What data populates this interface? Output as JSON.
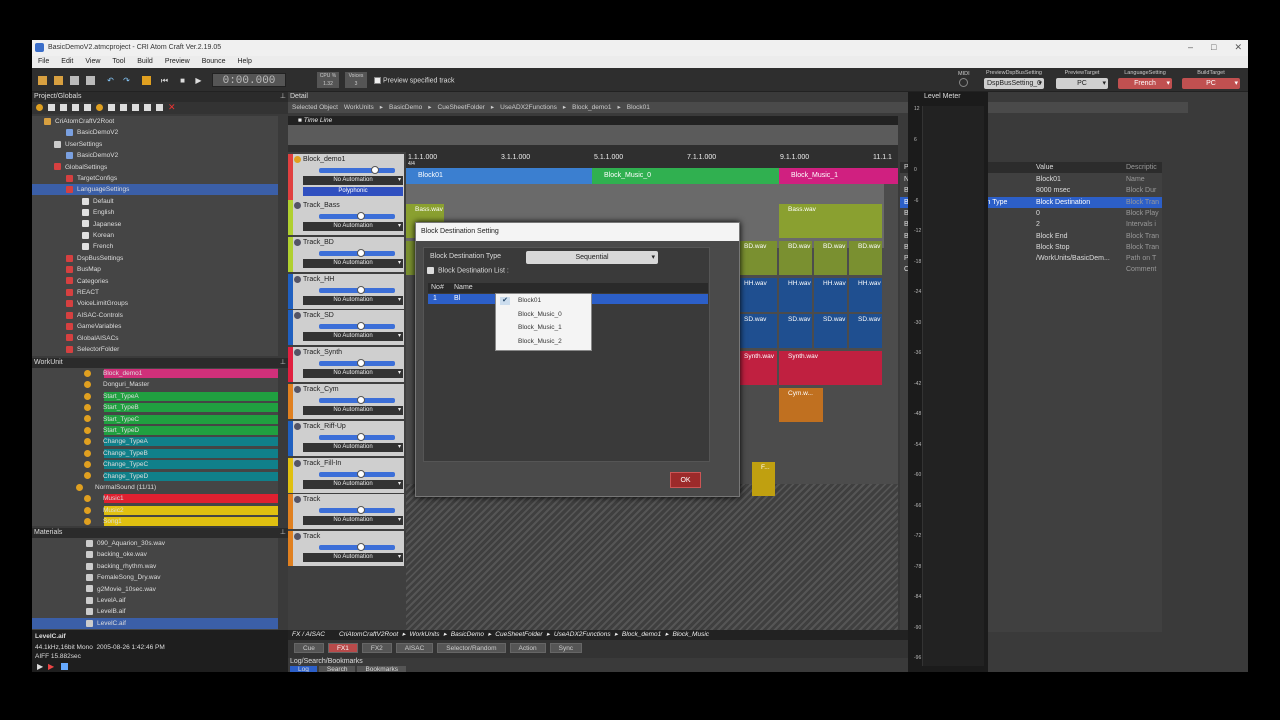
{
  "window": {
    "title": "BasicDemoV2.atmcproject - CRI Atom Craft Ver.2.19.05"
  },
  "menu": [
    "File",
    "Edit",
    "View",
    "Tool",
    "Build",
    "Preview",
    "Bounce",
    "Help"
  ],
  "toolbar": {
    "time": "0:00.000",
    "cpu_label": "CPU %",
    "cpu_value": "1.32",
    "voices_label": "Voices",
    "voices_value": "3",
    "preview_label": "Preview specified track",
    "midi_label": "MIDI",
    "selectors": [
      {
        "label": "PreviewDspBusSetting",
        "value": "DspBusSetting_0"
      },
      {
        "label": "PreviewTarget",
        "value": "PC"
      },
      {
        "label": "LanguageSetting",
        "value": "French"
      },
      {
        "label": "BuildTarget",
        "value": "PC"
      }
    ]
  },
  "project_panel": {
    "title": "Project/Globals",
    "items": [
      {
        "label": "CriAtomCraftV2Root",
        "color": "#d8a040"
      },
      {
        "label": "BasicDemoV2",
        "color": "#7aa0e0"
      },
      {
        "label": "UserSettings",
        "color": "#cccccc"
      },
      {
        "label": "BasicDemoV2",
        "color": "#7aa0e0"
      },
      {
        "label": "GlobalSettings",
        "color": "#d64040"
      },
      {
        "label": "TargetConfigs",
        "color": "#d64040"
      },
      {
        "label": "LanguageSettings",
        "color": "#d64040"
      },
      {
        "label": "Default",
        "color": "#e0e0e0"
      },
      {
        "label": "English",
        "color": "#e0e0e0"
      },
      {
        "label": "Japanese",
        "color": "#e0e0e0"
      },
      {
        "label": "Korean",
        "color": "#e0e0e0"
      },
      {
        "label": "French",
        "color": "#e0e0e0"
      },
      {
        "label": "DspBusSettings",
        "color": "#d64040"
      },
      {
        "label": "BusMap",
        "color": "#d64040"
      },
      {
        "label": "Categories",
        "color": "#d64040"
      },
      {
        "label": "REACT",
        "color": "#d64040"
      },
      {
        "label": "VoiceLimitGroups",
        "color": "#d64040"
      },
      {
        "label": "AISAC-Controls",
        "color": "#d64040"
      },
      {
        "label": "GameVariables",
        "color": "#d64040"
      },
      {
        "label": "GlobalAISACs",
        "color": "#d64040"
      },
      {
        "label": "SelectorFolder",
        "color": "#d64040"
      }
    ]
  },
  "workunit_panel": {
    "title": "WorkUnit",
    "items": [
      {
        "label": "Block_demo1",
        "color": "#d0307a"
      },
      {
        "label": "Donguri_Master",
        "color": ""
      },
      {
        "label": "Start_TypeA",
        "color": "#20a040"
      },
      {
        "label": "Start_TypeB",
        "color": "#20a040"
      },
      {
        "label": "Start_TypeC",
        "color": "#20a040"
      },
      {
        "label": "Start_TypeD",
        "color": "#20a040"
      },
      {
        "label": "Change_TypeA",
        "color": "#10808a"
      },
      {
        "label": "Change_TypeB",
        "color": "#10808a"
      },
      {
        "label": "Change_TypeC",
        "color": "#10808a"
      },
      {
        "label": "Change_TypeD",
        "color": "#10808a"
      },
      {
        "label": "NormalSound (11/11)",
        "color": ""
      },
      {
        "label": "Music1",
        "color": "#e02030"
      },
      {
        "label": "Music2",
        "color": "#e0c010"
      },
      {
        "label": "Song1",
        "color": "#e0c010"
      }
    ]
  },
  "materials_panel": {
    "title": "Materials",
    "items": [
      "090_Aquarion_30s.wav",
      "backing_oke.wav",
      "backing_rhythm.wav",
      "FemaleSong_Dry.wav",
      "g2Movie_10sec.wav",
      "LevelA.aif",
      "LevelB.aif",
      "LevelC.aif"
    ]
  },
  "file_info": {
    "name": "LevelC.aif",
    "format": "44.1kHz,16bit Mono",
    "date": "2005-08-26 1:42:46 PM",
    "type_len": "AIFF 15.882sec"
  },
  "detail": {
    "title": "Detail",
    "selected_label": "Selected Object",
    "path": [
      "WorkUnits",
      "BasicDemo",
      "CueSheetFolder",
      "UseADX2Functions",
      "Block_demo1",
      "Block01"
    ],
    "timeline_title": "Time Line"
  },
  "ruler": [
    "1.1.1.000",
    "3.1.1.000",
    "5.1.1.000",
    "7.1.1.000",
    "9.1.1.000",
    "11.1.1"
  ],
  "ruler_sub": "4/4",
  "blocks": [
    {
      "label": "Block01",
      "color": "#3b7fd0"
    },
    {
      "label": "Block_Music_0",
      "color": "#30b050"
    },
    {
      "label": "Block_Music_1",
      "color": "#d02080"
    }
  ],
  "tracks": [
    {
      "name": "Block_demo1",
      "color": "#e04040",
      "automation": "No Automation",
      "mode": "Polyphonic"
    },
    {
      "name": "Track_Bass",
      "color": "#b0d030",
      "automation": "No Automation"
    },
    {
      "name": "Track_BD",
      "color": "#b0d030",
      "automation": "No Automation"
    },
    {
      "name": "Track_HH",
      "color": "#2060c0",
      "automation": "No Automation"
    },
    {
      "name": "Track_SD",
      "color": "#2060c0",
      "automation": "No Automation"
    },
    {
      "name": "Track_Synth",
      "color": "#e02040",
      "automation": "No Automation"
    },
    {
      "name": "Track_Cym",
      "color": "#e08020",
      "automation": "No Automation"
    },
    {
      "name": "Track_Riff-Up",
      "color": "#2060c0",
      "automation": "No Automation"
    },
    {
      "name": "Track_Fill-In",
      "color": "#e0c010",
      "automation": "No Automation"
    },
    {
      "name": "Track",
      "color": "#e08020",
      "automation": "No Automation"
    },
    {
      "name": "Track",
      "color": "#e08020",
      "automation": "No Automation"
    }
  ],
  "clips": {
    "bass": "Bass.wav",
    "bd": "BD.wav",
    "hh": "HH.wav",
    "sd": "SD.wav",
    "synth": "Synth.wav",
    "cym": "Cym.w...",
    "fill": "F..."
  },
  "properties": {
    "headers": [
      "Property",
      "Value",
      "Descriptic"
    ],
    "rows": [
      {
        "p": "Name",
        "v": "Block01",
        "d": "Name"
      },
      {
        "p": "Block Duration",
        "v": "8000 msec",
        "d": "Block Dur"
      },
      {
        "p": "Block Transition Destination Type",
        "v": "Block Destination",
        "d": "Block Tran"
      },
      {
        "p": "Block Playback LoopNum",
        "v": "0",
        "d": "Block Play"
      },
      {
        "p": "Block- number of divisions",
        "v": "2",
        "d": "Intervals i"
      },
      {
        "p": "Block Transition Timing",
        "v": "Block End",
        "d": "Block Tran"
      },
      {
        "p": "Block Transition Behavior",
        "v": "Block Stop",
        "d": "Block Tran"
      },
      {
        "p": "Path",
        "v": "/WorkUnits/BasicDem...",
        "d": "Path on T"
      },
      {
        "p": "Comments",
        "v": "",
        "d": "Comment"
      }
    ]
  },
  "level_meter": {
    "title": "Level Meter",
    "ticks": [
      "12",
      "6",
      "0",
      "-6",
      "-12",
      "-18",
      "-24",
      "-30",
      "-36",
      "-42",
      "-48",
      "-54",
      "-60",
      "-66",
      "-72",
      "-78",
      "-84",
      "-90",
      "-96"
    ]
  },
  "fx": {
    "title": "FX / AISAC",
    "path": [
      "CriAtomCraftV2Root",
      "WorkUnits",
      "BasicDemo",
      "CueSheetFolder",
      "UseADX2Functions",
      "Block_demo1",
      "Block_Music"
    ],
    "tabs": [
      "Cue",
      "FX1",
      "FX2",
      "AISAC",
      "Selector/Random",
      "Action",
      "Sync"
    ]
  },
  "log": {
    "title": "Log/Search/Bookmarks",
    "tabs": [
      "Log",
      "Search",
      "Bookmarks"
    ]
  },
  "dialog": {
    "title": "Block Destination Setting",
    "type_label": "Block Destination Type",
    "type_value": "Sequential",
    "list_label": "Block Destination List :",
    "col_no": "No#",
    "col_name": "Name",
    "row_no": "1",
    "row_name": "Bl",
    "ok": "OK",
    "options": [
      "Block01",
      "Block_Music_0",
      "Block_Music_1",
      "Block_Music_2"
    ]
  }
}
